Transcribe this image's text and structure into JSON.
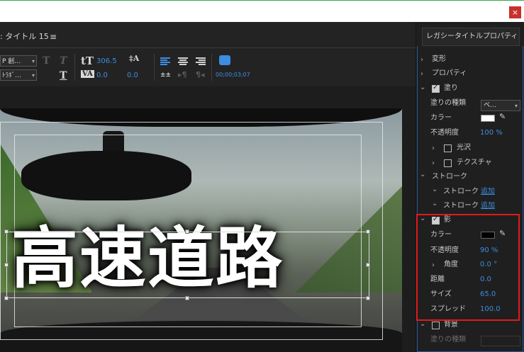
{
  "window": {
    "close_label": "×"
  },
  "editor": {
    "tab_label": ": タイトル 15",
    "menu_icon": "hamburger-icon",
    "toolbar": {
      "font_family": "P 創…",
      "font_style": "ﾄﾗﾎﾞ…",
      "font_size": "306.5",
      "kerning": "0.0",
      "leading": "0.0",
      "timecode": "00;00;03;07"
    },
    "canvas_text": "高速道路"
  },
  "panel": {
    "tab_label": "レガシータイトルプロパティ",
    "rows": {
      "transform": "変形",
      "properties": "プロパティ",
      "fill": "塗り",
      "fill_type": "塗りの種類",
      "fill_type_value": "ベ…",
      "color": "カラー",
      "opacity": "不透明度",
      "opacity_value": "100 %",
      "sheen": "光沢",
      "texture": "テクスチャ",
      "stroke": "ストローク",
      "inner_stroke": "ストローク",
      "inner_stroke_add": "追加",
      "outer_stroke": "ストローク",
      "outer_stroke_add": "追加",
      "shadow": "影",
      "shadow_color": "カラー",
      "shadow_opacity": "不透明度",
      "shadow_opacity_value": "90 %",
      "angle": "角度",
      "angle_value": "0.0 °",
      "distance": "距離",
      "distance_value": "0.0",
      "size": "サイズ",
      "size_value": "65.0",
      "spread": "スプレッド",
      "spread_value": "100.0",
      "background": "背景",
      "bg_fill_type": "塗りの種類"
    },
    "colors": {
      "fill": "#ffffff",
      "shadow": "#000000",
      "accent": "#3d8de0",
      "highlight": "#e21a1a"
    }
  }
}
